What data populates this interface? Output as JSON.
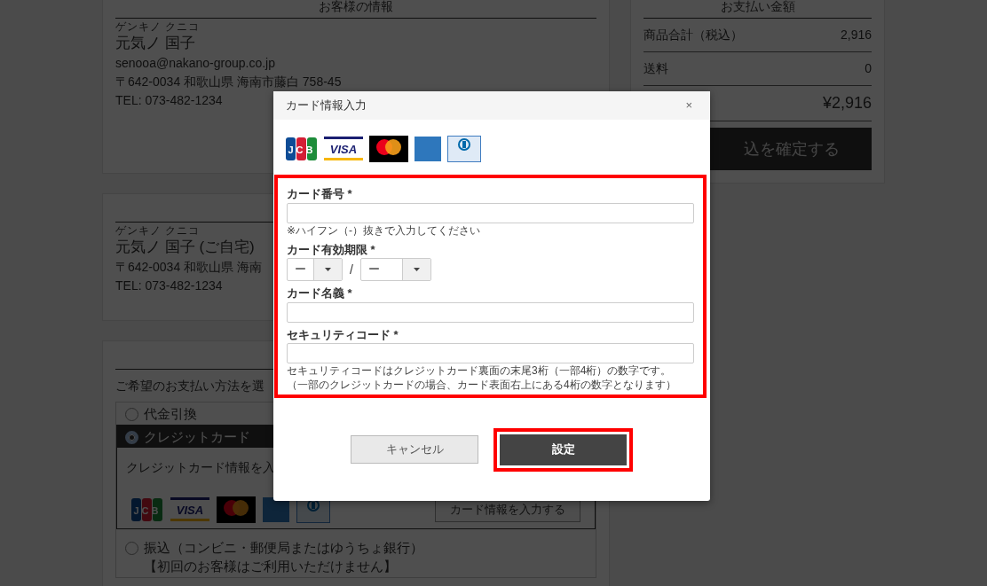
{
  "customer_card": {
    "heading": "お客様の情報",
    "kana": "ゲンキノ クニコ",
    "name": "元気ノ 国子",
    "email": "senooa@nakano-group.co.jp",
    "address": "〒642-0034 和歌山県 海南市藤白 758-45",
    "tel": "TEL: 073-482-1234"
  },
  "delivery_card": {
    "kana": "ゲンキノ クニコ",
    "name": "元気ノ 国子 (ご自宅)",
    "address": "〒642-0034 和歌山県 海南",
    "tel": "TEL: 073-482-1234"
  },
  "payment_method": {
    "prompt": "ご希望のお支払い方法を選",
    "options": [
      {
        "label": "代金引換",
        "selected": false
      },
      {
        "label": "クレジットカード",
        "selected": true,
        "description": "クレジットカード情報を入",
        "button": "カード情報を入力する",
        "card_logos": [
          {
            "kind": "jcb",
            "text": "JCB"
          },
          {
            "kind": "visa",
            "text": "VISA"
          },
          {
            "kind": "mastercard"
          },
          {
            "kind": "amex"
          },
          {
            "kind": "diners"
          }
        ]
      },
      {
        "label": "振込（コンビニ・郵便局またはゆうちょ銀行）",
        "selected": false,
        "note": "【初回のお客様はご利用いただけません】"
      }
    ]
  },
  "summary": {
    "heading": "お支払い金額",
    "rows": [
      {
        "label": "商品合計（税込）",
        "value": "2,916"
      },
      {
        "label": "送料",
        "value": "0"
      }
    ],
    "total_value": "¥2,916",
    "confirm_button": "込を確定する"
  },
  "dialog": {
    "title": "カード情報入力",
    "close": "×",
    "card_logos": [
      {
        "kind": "jcb",
        "text": "JCB"
      },
      {
        "kind": "visa",
        "text": "VISA"
      },
      {
        "kind": "mastercard"
      },
      {
        "kind": "amex"
      },
      {
        "kind": "diners"
      }
    ],
    "form_highlighted": true,
    "fields": [
      {
        "kind": "text",
        "label": "カード番号 *",
        "hint": [
          "※ハイフン（-）抜きで入力してください"
        ]
      },
      {
        "kind": "expiry",
        "label": "カード有効期限 *",
        "month": "ー",
        "year": "ー",
        "separator": "/"
      },
      {
        "kind": "text",
        "label": "カード名義 *"
      },
      {
        "kind": "text",
        "label": "セキュリティコード *",
        "hint": [
          "セキュリティコードはクレジットカード裏面の末尾3桁（一部4桁）の数字です。",
          "（一部のクレジットカードの場合、カード表面右上にある4桁の数字となります）"
        ]
      }
    ],
    "buttons": [
      {
        "kind": "secondary",
        "label": "キャンセル",
        "highlighted": false
      },
      {
        "kind": "primary",
        "label": "設定",
        "highlighted": true
      }
    ]
  }
}
